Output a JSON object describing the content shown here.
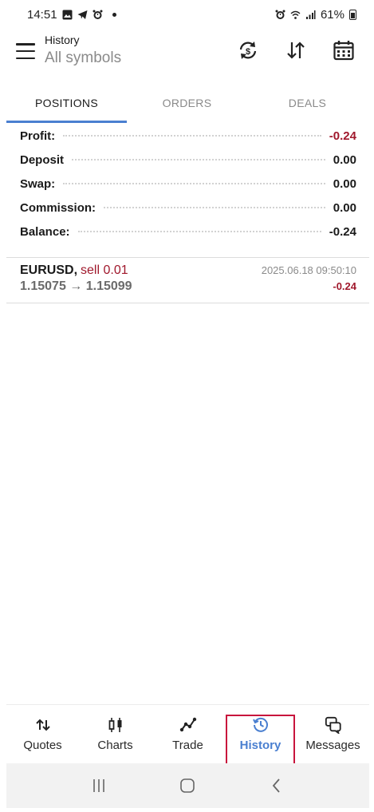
{
  "status_bar": {
    "time": "14:51",
    "battery": "61%",
    "icons": [
      "image-icon",
      "telegram-icon",
      "alarm-icon",
      "notification-dot",
      "alarm-icon",
      "wifi-icon",
      "signal-icon",
      "battery-icon"
    ]
  },
  "header": {
    "title": "History",
    "subtitle": "All symbols",
    "actions": [
      "refresh-dollar-icon",
      "sort-icon",
      "calendar-icon"
    ]
  },
  "tabs": [
    {
      "label": "POSITIONS",
      "active": true
    },
    {
      "label": "ORDERS",
      "active": false
    },
    {
      "label": "DEALS",
      "active": false
    }
  ],
  "summary": [
    {
      "label": "Profit:",
      "value": "-0.24",
      "negative": true
    },
    {
      "label": "Deposit",
      "value": "0.00",
      "negative": false
    },
    {
      "label": "Swap:",
      "value": "0.00",
      "negative": false
    },
    {
      "label": "Commission:",
      "value": "0.00",
      "negative": false
    },
    {
      "label": "Balance:",
      "value": "-0.24",
      "negative": false
    }
  ],
  "deals": [
    {
      "symbol": "EURUSD,",
      "action": "sell 0.01",
      "time": "2025.06.18 09:50:10",
      "prices": "1.15075 → 1.15099",
      "profit": "-0.24"
    }
  ],
  "bottom_nav": [
    {
      "label": "Quotes",
      "icon": "quotes-arrows-icon",
      "active": false
    },
    {
      "label": "Charts",
      "icon": "candlestick-icon",
      "active": false
    },
    {
      "label": "Trade",
      "icon": "trade-line-icon",
      "active": false
    },
    {
      "label": "History",
      "icon": "history-clock-icon",
      "active": true
    },
    {
      "label": "Messages",
      "icon": "messages-icon",
      "active": false
    }
  ],
  "colors": {
    "accent": "#4a7fd0",
    "negative": "#a0182c",
    "highlight_box": "#c8143c"
  }
}
